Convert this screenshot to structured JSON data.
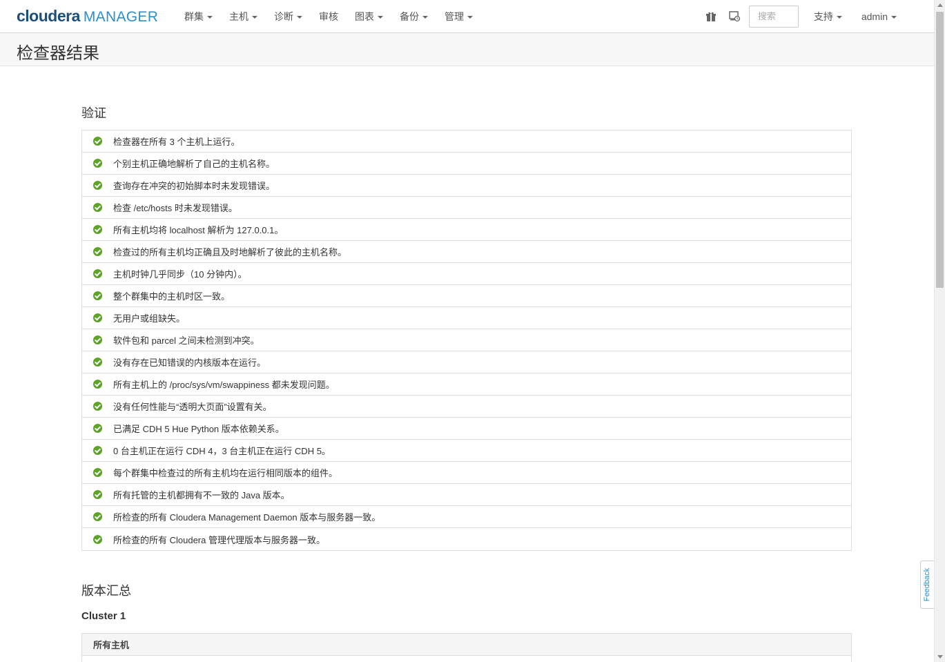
{
  "brand": {
    "name": "cloudera",
    "product": "MANAGER",
    "dark_color": "#1b4f7a",
    "accent_color": "#2a8fd0"
  },
  "nav": {
    "menus": [
      "群集",
      "主机",
      "诊断",
      "审核",
      "图表",
      "备份",
      "管理"
    ],
    "menus_with_caret": [
      true,
      true,
      true,
      false,
      true,
      true,
      true
    ],
    "parcel_icon": "gift-icon",
    "tasks_icon": "running-commands-icon",
    "search_placeholder": "搜索",
    "support_label": "支持",
    "user_label": "admin"
  },
  "page": {
    "title": "检查器结果"
  },
  "validation": {
    "title": "验证",
    "status_color": "#5aa325",
    "items": [
      "检查器在所有 3 个主机上运行。",
      "个别主机正确地解析了自己的主机名称。",
      "查询存在冲突的初始脚本时未发现错误。",
      "检查 /etc/hosts 时未发现错误。",
      "所有主机均将 localhost 解析为 127.0.0.1。",
      "检查过的所有主机均正确且及时地解析了彼此的主机名称。",
      "主机时钟几乎同步（10 分钟内）。",
      "整个群集中的主机时区一致。",
      "无用户或组缺失。",
      "软件包和 parcel 之间未检测到冲突。",
      "没有存在已知错误的内核版本在运行。",
      "所有主机上的 /proc/sys/vm/swappiness 都未发现问题。",
      "没有任何性能与“透明大页面”设置有关。",
      "已满足 CDH 5 Hue Python 版本依赖关系。",
      "0 台主机正在运行 CDH 4，3 台主机正在运行 CDH 5。",
      "每个群集中检查过的所有主机均在运行相同版本的组件。",
      "所有托管的主机都拥有不一致的 Java 版本。",
      "所检查的所有 Cloudera Management Daemon 版本与服务器一致。",
      "所检查的所有 Cloudera 管理代理版本与服务器一致。"
    ]
  },
  "version_summary": {
    "title": "版本汇总",
    "cluster_name": "Cluster 1",
    "table_header": "所有主机"
  },
  "feedback": {
    "label": "Feedback"
  }
}
